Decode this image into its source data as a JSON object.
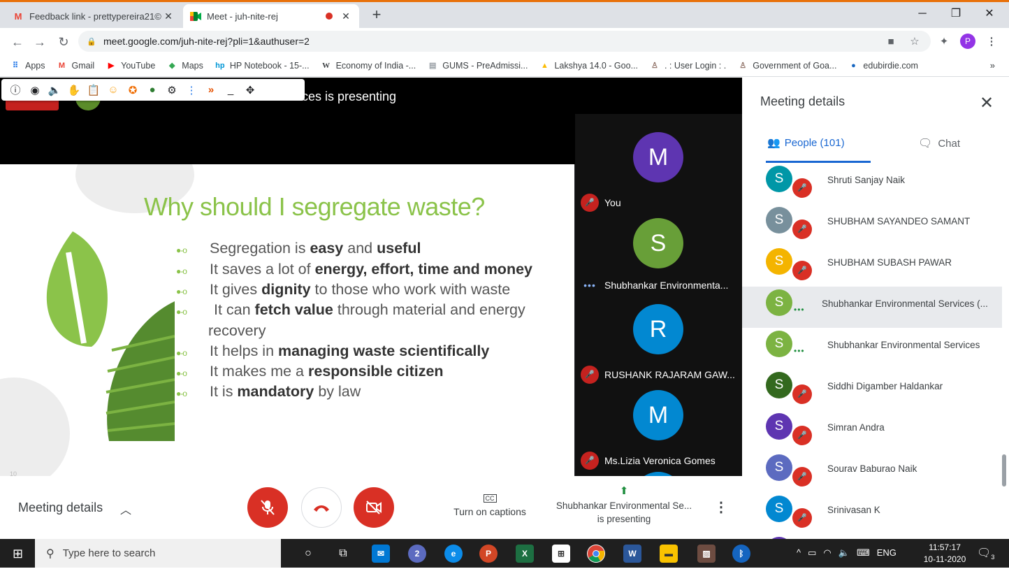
{
  "browser": {
    "tabs": [
      {
        "title": "Feedback link - prettypereira21©",
        "icon": "gmail-icon"
      },
      {
        "title": "Meet - juh-nite-rej",
        "icon": "meet-icon",
        "recording": true
      }
    ],
    "url": "meet.google.com/juh-nite-rej?pli=1&authuser=2",
    "profile_initial": "P",
    "bookmarks": [
      {
        "label": "Apps",
        "icon": "apps-grid-icon",
        "color": "#1a73e8"
      },
      {
        "label": "Gmail",
        "icon": "gmail-icon",
        "color": "#ea4335"
      },
      {
        "label": "YouTube",
        "icon": "youtube-icon",
        "color": "#ff0000"
      },
      {
        "label": "Maps",
        "icon": "maps-icon",
        "color": "#34a853"
      },
      {
        "label": "HP Notebook - 15-...",
        "icon": "hp-icon",
        "color": "#0096d6"
      },
      {
        "label": "Economy of India -...",
        "icon": "wikipedia-icon",
        "color": "#000000"
      },
      {
        "label": "GUMS - PreAdmissi...",
        "icon": "page-icon",
        "color": "#9aa0a6"
      },
      {
        "label": "Lakshya 14.0 - Goo...",
        "icon": "drive-icon",
        "color": "#fbbc04"
      },
      {
        "label": ". : User Login : .",
        "icon": "emblem-icon",
        "color": "#8d6e63"
      },
      {
        "label": "Government of Goa...",
        "icon": "emblem-icon",
        "color": "#8d6e63"
      },
      {
        "label": "edubirdie.com",
        "icon": "globe-icon",
        "color": "#1565c0"
      }
    ],
    "bookmarks_more": "»"
  },
  "meet": {
    "presenting_banner": "ces is presenting",
    "toolbar_icons": [
      "info-icon",
      "eye-icon",
      "speaker-icon",
      "hand-icon",
      "clipboard-icon",
      "emoji-icon",
      "badge-icon",
      "chat-bubble-icon",
      "gear-icon",
      "more-vert-icon",
      "expand-icon",
      "minimize-icon",
      "move-icon"
    ],
    "slide": {
      "title": "Why should I segregate waste?",
      "number": "10",
      "bullets": [
        [
          {
            "t": "Segregation is ",
            "b": false
          },
          {
            "t": "easy",
            "b": true
          },
          {
            "t": " and ",
            "b": false
          },
          {
            "t": "useful",
            "b": true
          }
        ],
        [
          {
            "t": "It saves a lot of ",
            "b": false
          },
          {
            "t": "energy, effort, time and money",
            "b": true
          }
        ],
        [
          {
            "t": "It gives ",
            "b": false
          },
          {
            "t": "dignity",
            "b": true
          },
          {
            "t": " to those who work with waste",
            "b": false
          }
        ],
        [
          {
            "t": " It can ",
            "b": false
          },
          {
            "t": "fetch value",
            "b": true
          },
          {
            "t": " through material and energy",
            "b": false
          }
        ],
        [
          {
            "t": "recovery",
            "b": false
          }
        ],
        [
          {
            "t": "It helps in ",
            "b": false
          },
          {
            "t": "managing waste scientifically",
            "b": true
          }
        ],
        [
          {
            "t": "It makes me a ",
            "b": false
          },
          {
            "t": "responsible citizen",
            "b": true
          }
        ],
        [
          {
            "t": "It is ",
            "b": false
          },
          {
            "t": "mandatory",
            "b": true
          },
          {
            "t": " by law",
            "b": false
          }
        ]
      ]
    },
    "tiles": [
      {
        "initial": "M",
        "name": "You",
        "color": "#5e35b1",
        "muted": true
      },
      {
        "initial": "S",
        "name": "Shubhankar Environmenta...",
        "color": "#689f38",
        "muted": false
      },
      {
        "initial": "R",
        "name": "RUSHANK RAJARAM GAW...",
        "color": "#0288d1",
        "muted": true
      },
      {
        "initial": "M",
        "name": "Ms.Lizia Veronica Gomes",
        "color": "#0288d1",
        "muted": true
      }
    ],
    "bottom": {
      "meeting_details": "Meeting details",
      "captions_label": "Turn on captions",
      "captions_icon": "CC",
      "presenting_line1": "Shubhankar Environmental Se...",
      "presenting_line2": "is presenting"
    },
    "panel": {
      "title": "Meeting details",
      "people_tab": "People (101)",
      "chat_tab": "Chat",
      "people": [
        {
          "initial": "S",
          "name": "Shruti Sanjay Naik",
          "color": "#0097a7",
          "status": "muted"
        },
        {
          "initial": "S",
          "name": "SHUBHAM SAYANDEO SAMANT",
          "color": "#78909c",
          "status": "muted"
        },
        {
          "initial": "S",
          "name": "SHUBHAM SUBASH PAWAR",
          "color": "#f4b400",
          "status": "muted"
        },
        {
          "initial": "S",
          "name": "Shubhankar Environmental Services (...",
          "color": "#7cb342",
          "status": "talking",
          "highlight": true
        },
        {
          "initial": "S",
          "name": "Shubhankar Environmental Services",
          "color": "#7cb342",
          "status": "talking"
        },
        {
          "initial": "S",
          "name": "Siddhi Digamber Haldankar",
          "color": "#33691e",
          "status": "muted"
        },
        {
          "initial": "S",
          "name": "Simran Andra",
          "color": "#5e35b1",
          "status": "muted"
        },
        {
          "initial": "S",
          "name": "Sourav Baburao Naik",
          "color": "#5c6bc0",
          "status": "muted"
        },
        {
          "initial": "S",
          "name": "Srinivasan K",
          "color": "#0288d1",
          "status": "muted"
        }
      ]
    }
  },
  "taskbar": {
    "search_placeholder": "Type here to search",
    "time": "11:57:17",
    "date": "10-11-2020",
    "lang": "ENG",
    "notifications": "3"
  }
}
